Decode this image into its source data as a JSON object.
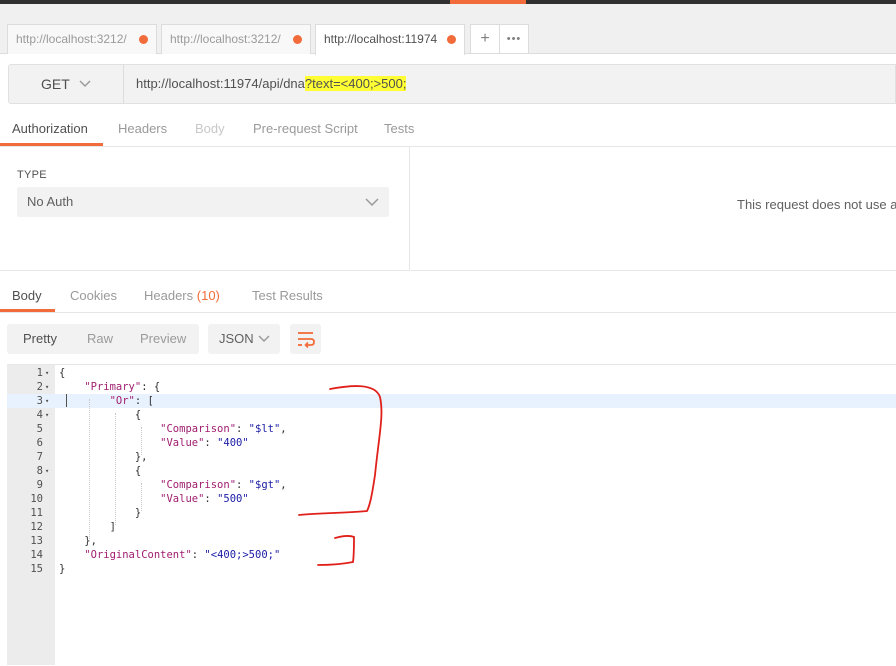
{
  "tabs": [
    {
      "label": "http://localhost:3212/",
      "active": false
    },
    {
      "label": "http://localhost:3212/",
      "active": false
    },
    {
      "label": "http://localhost:11974",
      "active": true
    }
  ],
  "tab_actions": {
    "add": "+",
    "more": "•••"
  },
  "request": {
    "method": "GET",
    "url_plain": "http://localhost:11974/api/dna",
    "url_highlighted": "?text=<400;>500;"
  },
  "request_tabs": [
    {
      "label": "Authorization",
      "state": "active"
    },
    {
      "label": "Headers",
      "state": "normal"
    },
    {
      "label": "Body",
      "state": "disabled"
    },
    {
      "label": "Pre-request Script",
      "state": "normal"
    },
    {
      "label": "Tests",
      "state": "normal"
    }
  ],
  "auth": {
    "type_label": "TYPE",
    "type_value": "No Auth",
    "message": "This request does not use an"
  },
  "response_tabs": [
    {
      "label": "Body",
      "active": true
    },
    {
      "label": "Cookies",
      "active": false
    },
    {
      "label": "Headers",
      "count": "(10)",
      "active": false
    },
    {
      "label": "Test Results",
      "active": false
    }
  ],
  "view_modes": [
    "Pretty",
    "Raw",
    "Preview"
  ],
  "active_view_mode": "Pretty",
  "language": "JSON",
  "code_lines": [
    {
      "n": "1",
      "fold": true,
      "text": "{"
    },
    {
      "n": "2",
      "fold": true,
      "text": "    \"Primary\": {"
    },
    {
      "n": "3",
      "fold": true,
      "text": "        \"Or\": ["
    },
    {
      "n": "4",
      "fold": true,
      "text": "            {"
    },
    {
      "n": "5",
      "fold": false,
      "text": "                \"Comparison\": \"$lt\","
    },
    {
      "n": "6",
      "fold": false,
      "text": "                \"Value\": \"400\""
    },
    {
      "n": "7",
      "fold": false,
      "text": "            },"
    },
    {
      "n": "8",
      "fold": true,
      "text": "            {"
    },
    {
      "n": "9",
      "fold": false,
      "text": "                \"Comparison\": \"$gt\","
    },
    {
      "n": "10",
      "fold": false,
      "text": "                \"Value\": \"500\""
    },
    {
      "n": "11",
      "fold": false,
      "text": "            }"
    },
    {
      "n": "12",
      "fold": false,
      "text": "        ]"
    },
    {
      "n": "13",
      "fold": false,
      "text": "    },"
    },
    {
      "n": "14",
      "fold": false,
      "text": "    \"OriginalContent\": \"<400;>500;\""
    },
    {
      "n": "15",
      "fold": false,
      "text": "}"
    }
  ],
  "highlighted_line": "3",
  "colors": {
    "accent": "#f26b3a",
    "key": "#a11d6f",
    "string": "#1a1aa6",
    "url_highlight": "#ffff33",
    "annotation": "#e0201a"
  }
}
